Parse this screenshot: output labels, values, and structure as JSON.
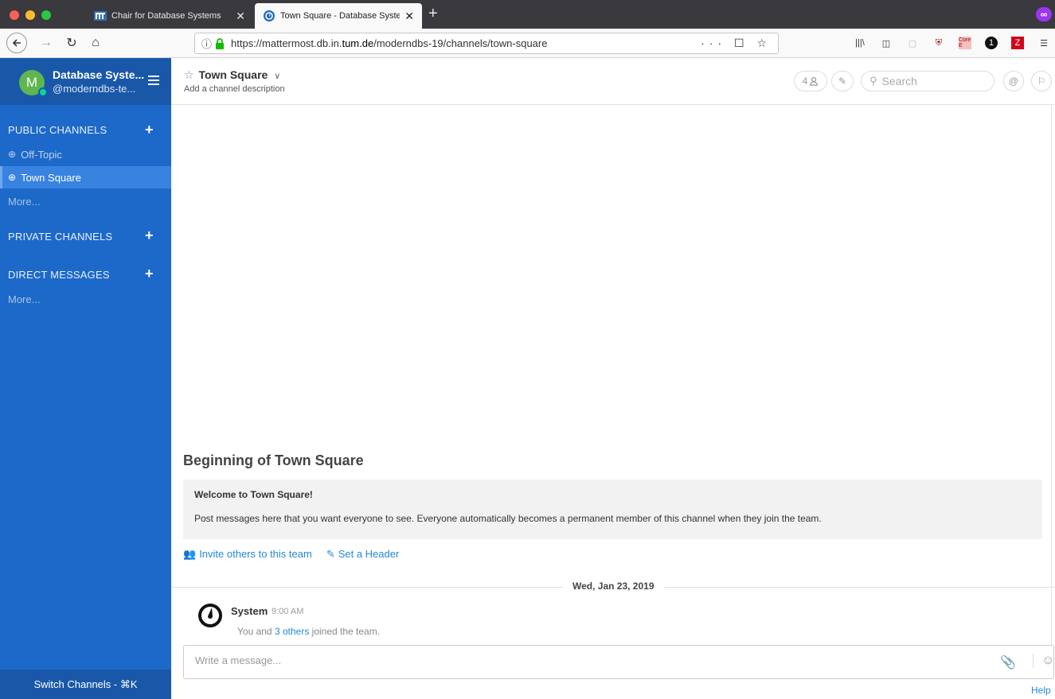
{
  "browser": {
    "tabs": [
      {
        "title": "Chair for Database Systems",
        "active": false
      },
      {
        "title": "Town Square - Database Syster",
        "active": true
      }
    ],
    "url_prefix": "https://mattermost.db.in.",
    "url_domain": "tum.de",
    "url_path": "/moderndbs-19/channels/town-square",
    "ext_badge_text": "Core E"
  },
  "sidebar": {
    "team_initial": "M",
    "team_name": "Database Syste...",
    "team_user": "@moderndbs-te...",
    "public_title": "PUBLIC CHANNELS",
    "public_channels": [
      {
        "label": "Off-Topic",
        "active": false
      },
      {
        "label": "Town Square",
        "active": true
      }
    ],
    "public_more": "More...",
    "private_title": "PRIVATE CHANNELS",
    "direct_title": "DIRECT MESSAGES",
    "direct_more": "More...",
    "switch_label": "Switch Channels - ⌘K"
  },
  "header": {
    "channel_name": "Town Square",
    "description": "Add a channel description",
    "member_count": "4",
    "search_placeholder": "Search"
  },
  "intro": {
    "title": "Beginning of Town Square",
    "welcome_title": "Welcome to Town Square!",
    "welcome_text": "Post messages here that you want everyone to see. Everyone automatically becomes a permanent member of this channel when they join the team.",
    "invite_link": "Invite others to this team",
    "header_link": "Set a Header"
  },
  "post": {
    "date": "Wed, Jan 23, 2019",
    "user": "System",
    "time": "9:00 AM",
    "msg_prefix": "You and ",
    "msg_link": "3 others",
    "msg_suffix": " joined the team."
  },
  "composer": {
    "placeholder": "Write a message...",
    "help": "Help"
  },
  "colors": {
    "sidebar": "#1d69c9",
    "sidebar_header": "#1958a9",
    "link": "#2389d7",
    "status_online": "#06d6a0"
  }
}
